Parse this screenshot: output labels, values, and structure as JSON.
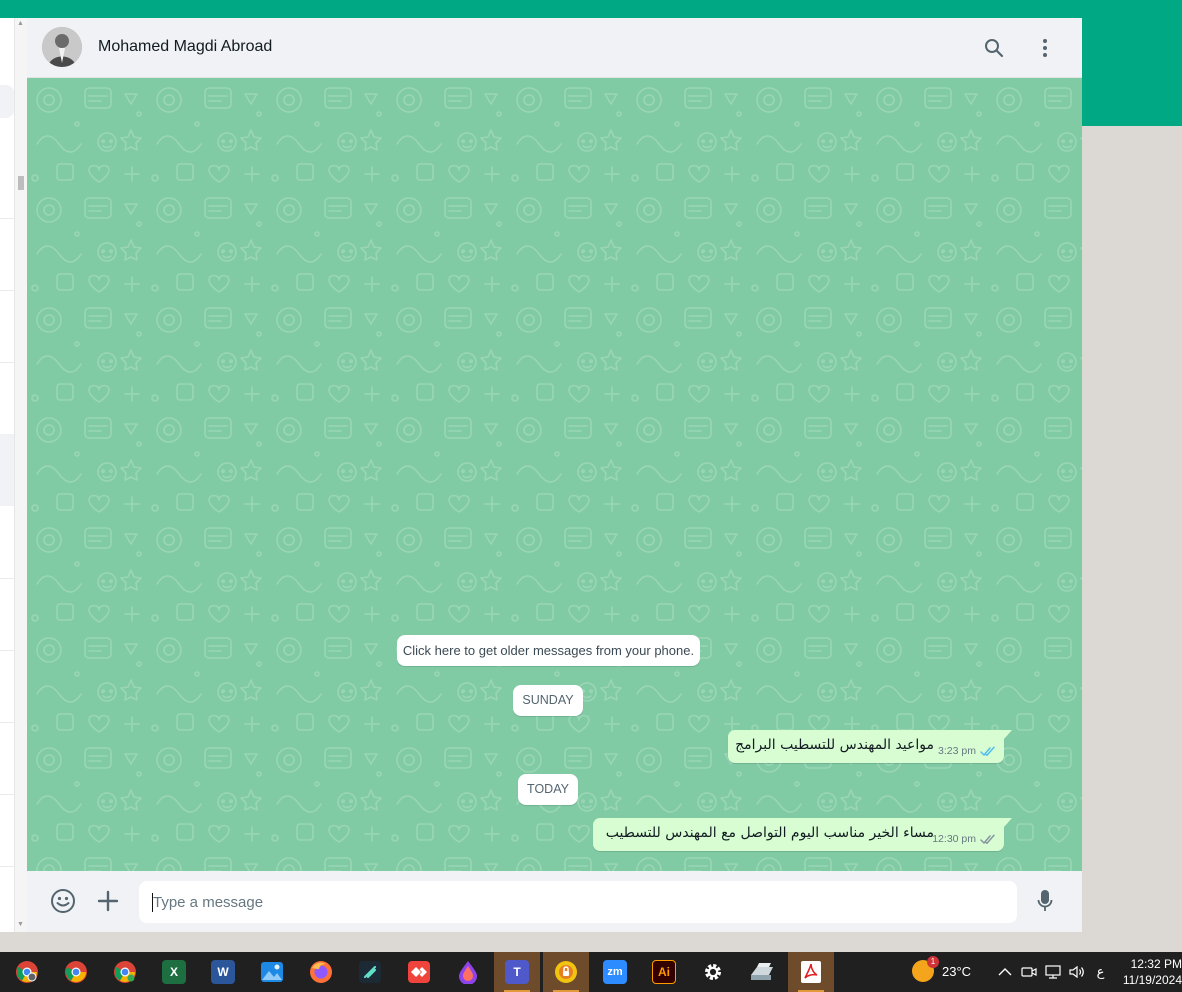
{
  "chat": {
    "contact_name": "Mohamed Magdi Abroad",
    "older_messages_prompt": "Click here to get older messages from your phone.",
    "day_labels": [
      "SUNDAY",
      "TODAY"
    ],
    "messages": [
      {
        "text": "مواعيد المهندس للتسطيب البرامج",
        "time": "3:23 pm",
        "status": "read"
      },
      {
        "text": "مساء الخير مناسب اليوم التواصل مع المهندس للتسطيب",
        "time": "12:30 pm",
        "status": "read"
      }
    ],
    "input_placeholder": "Type a message"
  },
  "colors": {
    "brand": "#00a884",
    "chat_background": "#80caa4",
    "outgoing_bubble": "#d9fdd3",
    "read_ticks": "#53bdeb",
    "header_background": "#f0f2f5"
  },
  "taskbar": {
    "apps": [
      {
        "name": "chrome-profile",
        "icon": "chrome-icon"
      },
      {
        "name": "chrome",
        "icon": "chrome-icon"
      },
      {
        "name": "chrome-web",
        "icon": "chrome-icon"
      },
      {
        "name": "excel",
        "icon": "excel-icon"
      },
      {
        "name": "word",
        "icon": "word-icon"
      },
      {
        "name": "photos",
        "icon": "photos-icon"
      },
      {
        "name": "firefox",
        "icon": "firefox-icon"
      },
      {
        "name": "filmora",
        "icon": "filmora-icon"
      },
      {
        "name": "anydesk",
        "icon": "anydesk-icon"
      },
      {
        "name": "drop",
        "icon": "drop-icon"
      },
      {
        "name": "teams",
        "icon": "teams-icon"
      },
      {
        "name": "vpn",
        "icon": "vpn-icon"
      },
      {
        "name": "zoom",
        "icon": "zoom-icon",
        "label": "zm"
      },
      {
        "name": "illustrator",
        "icon": "illustrator-icon",
        "label": "Ai"
      },
      {
        "name": "settings",
        "icon": "gear-icon"
      },
      {
        "name": "scanner",
        "icon": "scanner-icon"
      },
      {
        "name": "acrobat",
        "icon": "acrobat-icon"
      }
    ],
    "weather": {
      "temperature": "23°C",
      "badge": "1"
    },
    "tray": {
      "input_language": "ع"
    },
    "time": "12:32 PM",
    "date": "11/19/2024"
  }
}
